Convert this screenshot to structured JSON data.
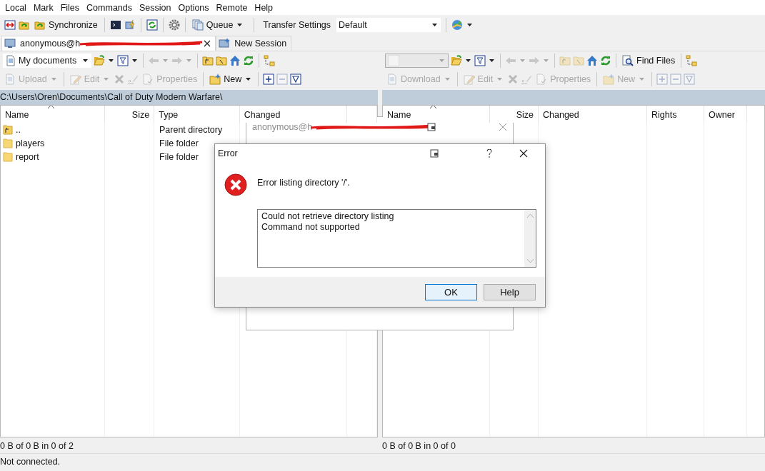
{
  "menu": [
    "Local",
    "Mark",
    "Files",
    "Commands",
    "Session",
    "Options",
    "Remote",
    "Help"
  ],
  "toolbar": {
    "synchronize": "Synchronize",
    "queue": "Queue",
    "transfer_label": "Transfer Settings",
    "transfer_value": "Default"
  },
  "session_tabs": [
    {
      "label": "anonymous@h",
      "redacted": true,
      "selected": true,
      "closable": true
    },
    {
      "label": "New Session",
      "redacted": false,
      "selected": false,
      "closable": false
    }
  ],
  "left_pane": {
    "location": "My documents",
    "actions": [
      {
        "label": "Upload",
        "disabled": true,
        "dropdown": true
      },
      {
        "label": "Edit",
        "disabled": true,
        "dropdown": true
      },
      {
        "label": "Properties",
        "disabled": true,
        "dropdown": false
      },
      {
        "label": "New",
        "disabled": false,
        "dropdown": true
      }
    ],
    "path": "C:\\Users\\Oren\\Documents\\Call of Duty Modern Warfare\\",
    "columns": [
      {
        "label": "Name",
        "sorted": true
      },
      {
        "label": "Size",
        "sorted": false
      },
      {
        "label": "Type",
        "sorted": false
      },
      {
        "label": "Changed",
        "sorted": false
      }
    ],
    "rows": [
      {
        "kind": "parent",
        "name": "..",
        "type": "Parent directory"
      },
      {
        "kind": "folder",
        "name": "players",
        "type": "File folder"
      },
      {
        "kind": "folder",
        "name": "report",
        "type": "File folder"
      }
    ],
    "status": "0 B of 0 B in 0 of 2"
  },
  "right_pane": {
    "find_files": "Find Files",
    "actions": [
      {
        "label": "Download",
        "disabled": true,
        "dropdown": true
      },
      {
        "label": "Edit",
        "disabled": true,
        "dropdown": true
      },
      {
        "label": "Properties",
        "disabled": true,
        "dropdown": false
      },
      {
        "label": "New",
        "disabled": true,
        "dropdown": true
      }
    ],
    "columns": [
      {
        "label": "Name",
        "sorted": true
      },
      {
        "label": "Size",
        "sorted": false
      },
      {
        "label": "Changed",
        "sorted": false
      },
      {
        "label": "Rights",
        "sorted": false
      },
      {
        "label": "Owner",
        "sorted": false
      }
    ],
    "status": "0 B of 0 B in 0 of 0"
  },
  "status_bar": "Not connected.",
  "background_dialog": {
    "title": "anonymous@h",
    "redacted": true
  },
  "error_dialog": {
    "title": "Error",
    "message": "Error listing directory '/'.",
    "details": [
      "Could not retrieve directory listing",
      "Command not supported"
    ],
    "buttons": [
      {
        "label": "OK",
        "selected": true
      },
      {
        "label": "Help",
        "selected": false
      }
    ]
  }
}
